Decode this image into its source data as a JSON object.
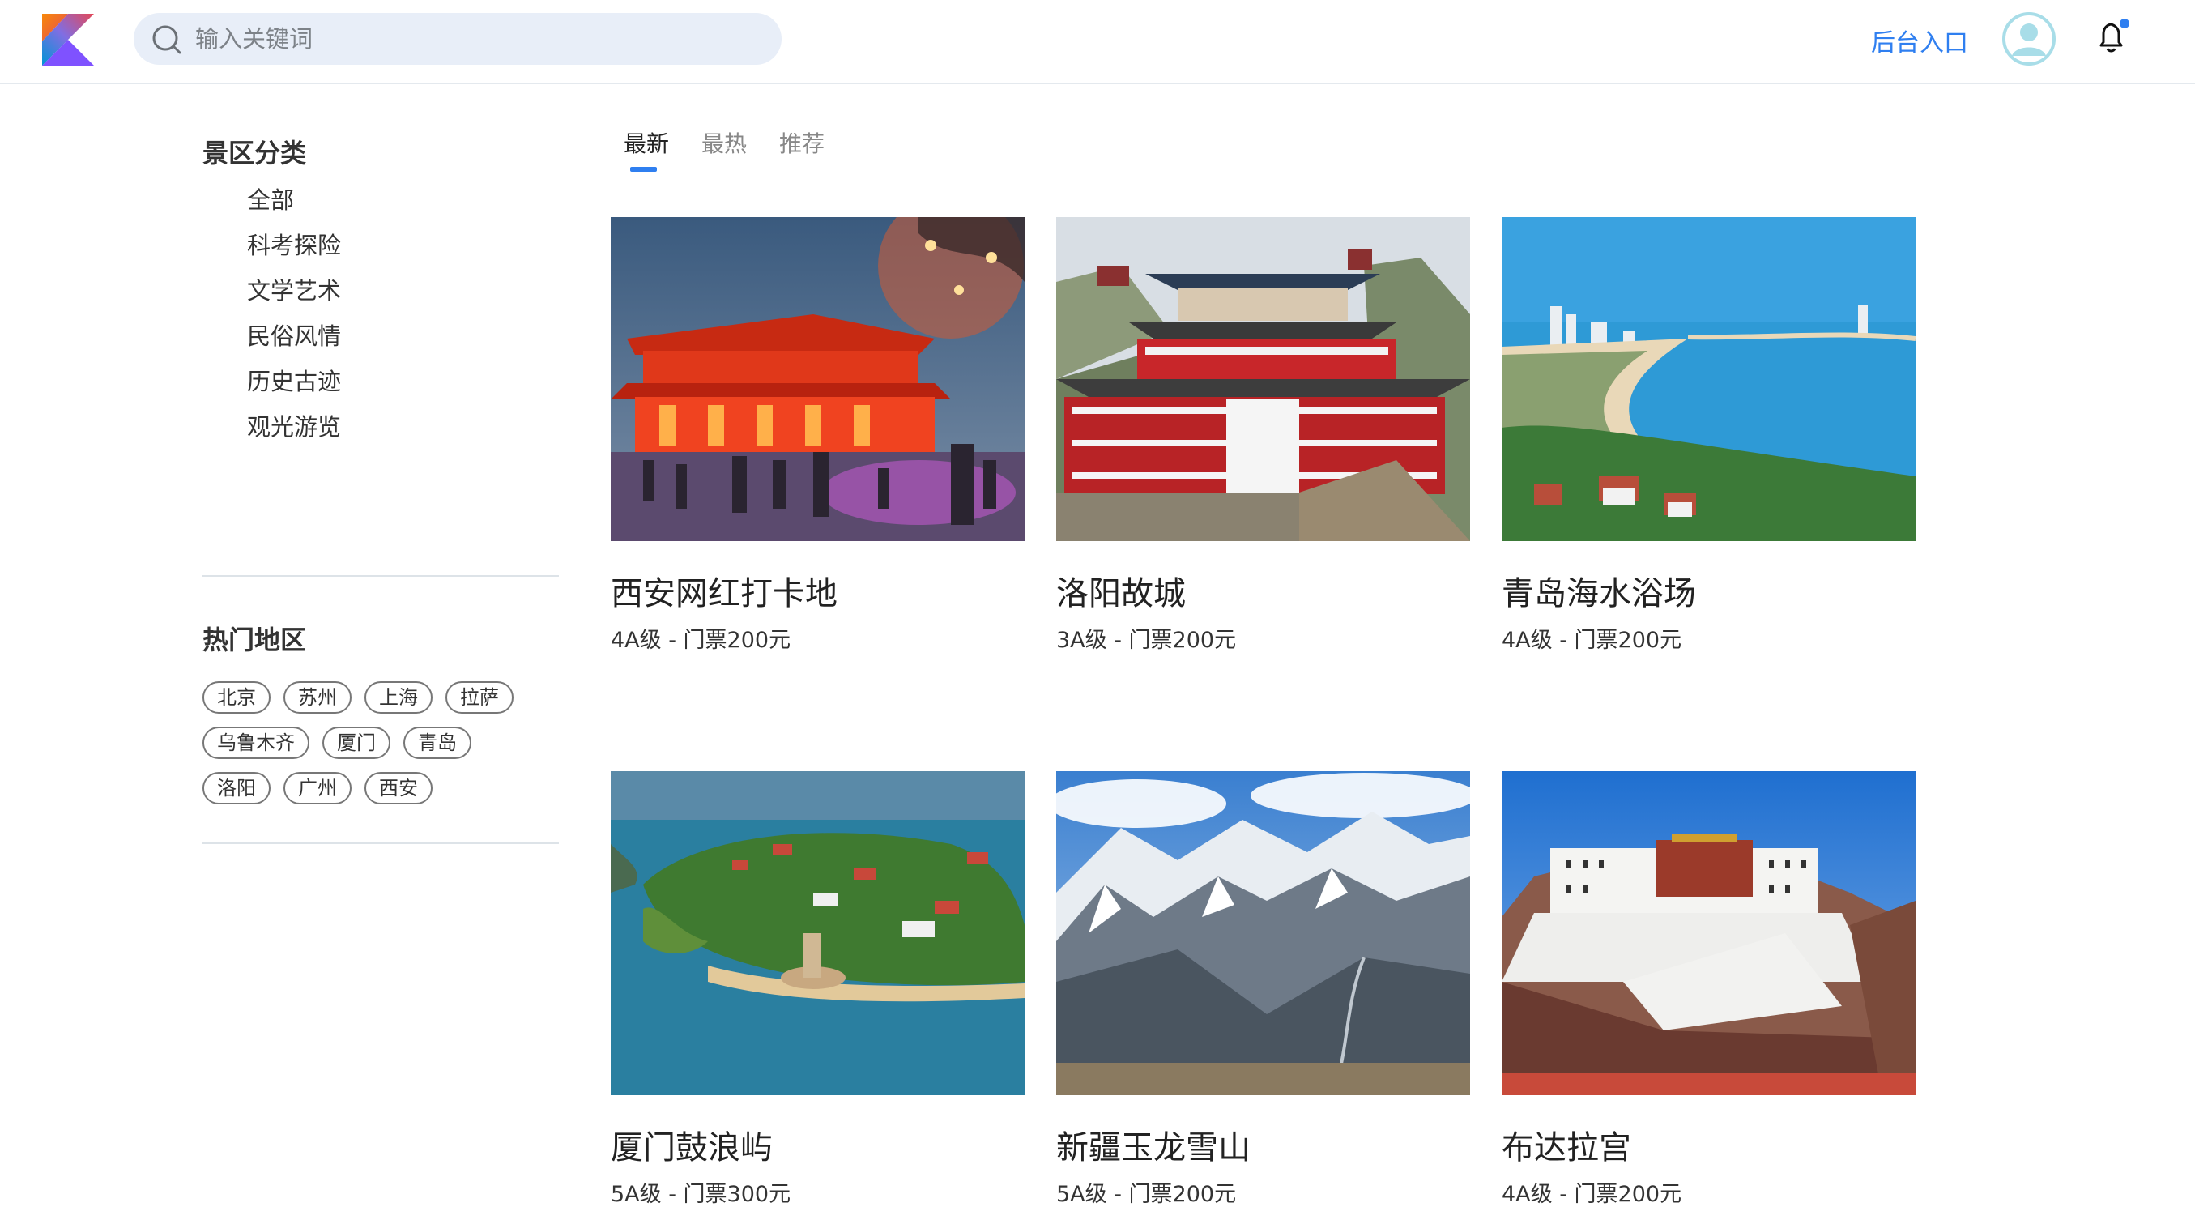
{
  "header": {
    "logo_icon": "kotlin-logo",
    "search_placeholder": "输入关键词",
    "search_value": "",
    "admin_link": "后台入口",
    "avatar_icon": "user-avatar-icon",
    "bell_icon": "bell-icon",
    "notification_dot_color": "#2f7ff0"
  },
  "sidebar": {
    "categories_title": "景区分类",
    "categories": [
      "全部",
      "科考探险",
      "文学艺术",
      "民俗风情",
      "历史古迹",
      "观光游览"
    ],
    "regions_title": "热门地区",
    "regions": [
      [
        "北京",
        "苏州",
        "上海",
        "拉萨"
      ],
      [
        "乌鲁木齐",
        "厦门",
        "青岛"
      ],
      [
        "洛阳",
        "广州",
        "西安"
      ]
    ]
  },
  "tabs": [
    {
      "label": "最新",
      "active": true
    },
    {
      "label": "最热",
      "active": false
    },
    {
      "label": "推荐",
      "active": false
    }
  ],
  "cards": [
    {
      "name": "西安网红打卡地",
      "info": "4A级 - 门票200元",
      "image": "night-palace-red-lights"
    },
    {
      "name": "洛阳故城",
      "info": "3A级 - 门票200元",
      "image": "cliff-temple-red-white"
    },
    {
      "name": "青岛海水浴场",
      "info": "4A级 - 门票200元",
      "image": "coastal-bay-beach-city"
    },
    {
      "name": "厦门鼓浪屿",
      "info": "5A级 - 门票300元",
      "image": "green-island-aerial"
    },
    {
      "name": "新疆玉龙雪山",
      "info": "5A级 - 门票200元",
      "image": "snow-mountain-range"
    },
    {
      "name": "布达拉宫",
      "info": "4A级 - 门票200元",
      "image": "potala-palace"
    }
  ],
  "accent_color": "#2f7ff0"
}
